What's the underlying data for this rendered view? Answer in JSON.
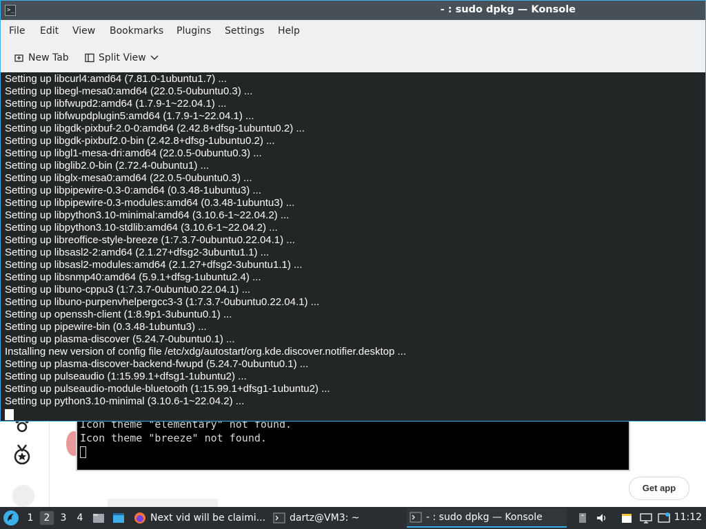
{
  "window": {
    "title": "- : sudo dpkg — Konsole"
  },
  "menubar": {
    "items": [
      "File",
      "Edit",
      "View",
      "Bookmarks",
      "Plugins",
      "Settings",
      "Help"
    ]
  },
  "toolbar": {
    "new_tab_label": "New Tab",
    "split_view_label": "Split View"
  },
  "terminal": {
    "lines": [
      "Setting up libcurl4:amd64 (7.81.0-1ubuntu1.7) ...",
      "Setting up libegl-mesa0:amd64 (22.0.5-0ubuntu0.3) ...",
      "Setting up libfwupd2:amd64 (1.7.9-1~22.04.1) ...",
      "Setting up libfwupdplugin5:amd64 (1.7.9-1~22.04.1) ...",
      "Setting up libgdk-pixbuf-2.0-0:amd64 (2.42.8+dfsg-1ubuntu0.2) ...",
      "Setting up libgdk-pixbuf2.0-bin (2.42.8+dfsg-1ubuntu0.2) ...",
      "Setting up libgl1-mesa-dri:amd64 (22.0.5-0ubuntu0.3) ...",
      "Setting up libglib2.0-bin (2.72.4-0ubuntu1) ...",
      "Setting up libglx-mesa0:amd64 (22.0.5-0ubuntu0.3) ...",
      "Setting up libpipewire-0.3-0:amd64 (0.3.48-1ubuntu3) ...",
      "Setting up libpipewire-0.3-modules:amd64 (0.3.48-1ubuntu3) ...",
      "Setting up libpython3.10-minimal:amd64 (3.10.6-1~22.04.2) ...",
      "Setting up libpython3.10-stdlib:amd64 (3.10.6-1~22.04.2) ...",
      "Setting up libreoffice-style-breeze (1:7.3.7-0ubuntu0.22.04.1) ...",
      "Setting up libsasl2-2:amd64 (2.1.27+dfsg2-3ubuntu1.1) ...",
      "Setting up libsasl2-modules:amd64 (2.1.27+dfsg2-3ubuntu1.1) ...",
      "Setting up libsnmp40:amd64 (5.9.1+dfsg-1ubuntu2.4) ...",
      "Setting up libuno-cppu3 (1:7.3.7-0ubuntu0.22.04.1) ...",
      "Setting up libuno-purpenvhelpergcc3-3 (1:7.3.7-0ubuntu0.22.04.1) ...",
      "Setting up openssh-client (1:8.9p1-3ubuntu0.1) ...",
      "Setting up pipewire-bin (0.3.48-1ubuntu3) ...",
      "Setting up plasma-discover (5.24.7-0ubuntu0.1) ...",
      "Installing new version of config file /etc/xdg/autostart/org.kde.discover.notifier.desktop ...",
      "Setting up plasma-discover-backend-fwupd (5.24.7-0ubuntu0.1) ...",
      "Setting up pulseaudio (1:15.99.1+dfsg1-1ubuntu2) ...",
      "Setting up pulseaudio-module-bluetooth (1:15.99.1+dfsg1-1ubuntu2) ...",
      "Setting up python3.10-minimal (3.10.6-1~22.04.2) ..."
    ]
  },
  "background_page": {
    "terminal_lines": [
      "Icon theme \"elementary\" not found.",
      "Icon theme \"breeze\" not found."
    ],
    "get_app_label": "Get app"
  },
  "panel": {
    "desktops": [
      "1",
      "2",
      "3",
      "4"
    ],
    "active_desktop": "2",
    "tasks": [
      {
        "label": "Next vid will be claimi...",
        "icon": "firefox-icon"
      },
      {
        "label": "dartz@VM3: ~",
        "icon": "terminal-icon"
      },
      {
        "label": "- : sudo dpkg — Konsole",
        "icon": "terminal-icon"
      }
    ],
    "clock": "11:12"
  },
  "colors": {
    "accent": "#3daee9",
    "terminal_bg": "#232627",
    "titlebar_bg": "#475057",
    "panel_bg": "#2a2e32"
  }
}
